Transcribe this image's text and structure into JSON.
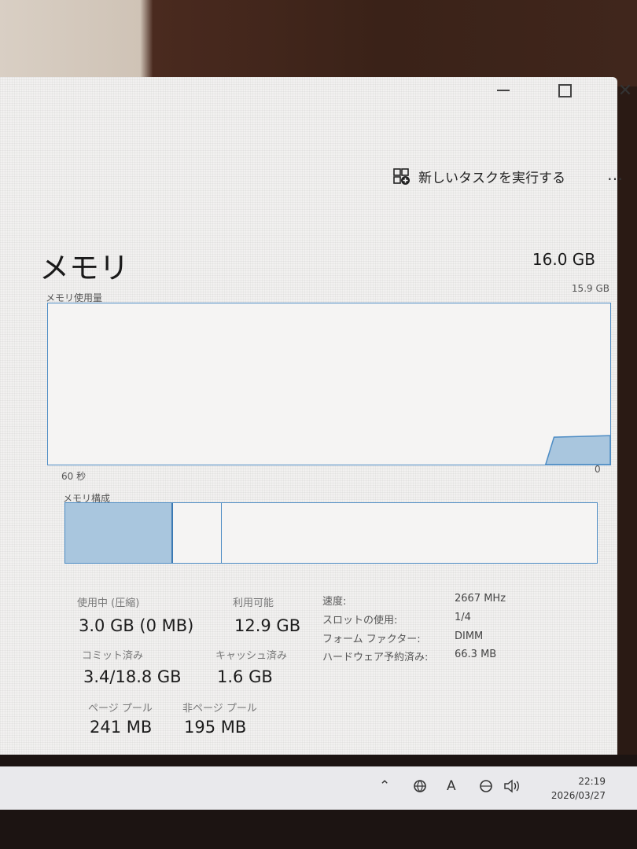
{
  "window": {
    "run_task_label": "新しいタスクを実行する",
    "more_label": "…"
  },
  "memory": {
    "title": "メモリ",
    "capacity": "16.0 GB",
    "usage_label": "メモリ使用量",
    "usage_max": "15.9 GB",
    "axis_left": "60 秒",
    "axis_right": "0",
    "composition_label": "メモリ構成",
    "usage_history_fraction": [
      0,
      0,
      0,
      0,
      0,
      0,
      0,
      0,
      0,
      0.17,
      0.18
    ],
    "composition_fractions": {
      "in_use": 0.2,
      "modified": 0.09
    }
  },
  "stats": {
    "in_use_label": "使用中 (圧縮)",
    "in_use_value": "3.0 GB (0 MB)",
    "available_label": "利用可能",
    "available_value": "12.9 GB",
    "committed_label": "コミット済み",
    "committed_value": "3.4/18.8 GB",
    "cached_label": "キャッシュ済み",
    "cached_value": "1.6 GB",
    "paged_pool_label": "ページ プール",
    "paged_pool_value": "241 MB",
    "nonpaged_pool_label": "非ページ プール",
    "nonpaged_pool_value": "195 MB"
  },
  "details": {
    "speed_label": "速度:",
    "speed_value": "2667 MHz",
    "slots_label": "スロットの使用:",
    "slots_value": "1/4",
    "form_factor_label": "フォーム ファクター:",
    "form_factor_value": "DIMM",
    "hw_reserved_label": "ハードウェア予約済み:",
    "hw_reserved_value": "66.3 MB"
  },
  "taskbar": {
    "ime_label": "A",
    "time": "22:19",
    "date": "2026/03/27"
  },
  "colors": {
    "graph_border": "#4d8cc4",
    "graph_fill": "#a9c6de"
  }
}
